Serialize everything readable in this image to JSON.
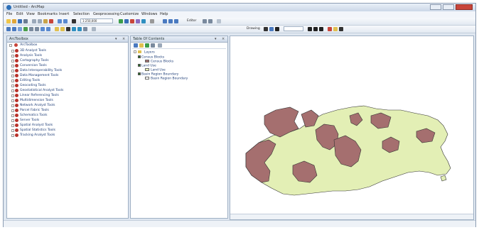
{
  "window": {
    "title": "Untitled - ArcMap",
    "controls": [
      "minimize",
      "maximize",
      "close"
    ]
  },
  "menubar": {
    "items": [
      "File",
      "Edit",
      "View",
      "Bookmarks",
      "Insert",
      "Selection",
      "Geoprocessing",
      "Customize",
      "Windows",
      "Help"
    ]
  },
  "toolbar": {
    "scale_value": "1:250,000",
    "editor_label": "Editor",
    "drawing_label": "Drawing"
  },
  "toolbox_pane": {
    "title": "ArcToolbox",
    "root": "ArcToolbox",
    "items": [
      "3D Analyst Tools",
      "Analysis Tools",
      "Cartography Tools",
      "Conversion Tools",
      "Data Interoperability Tools",
      "Data Management Tools",
      "Editing Tools",
      "Geocoding Tools",
      "Geostatistical Analyst Tools",
      "Linear Referencing Tools",
      "Multidimension Tools",
      "Network Analyst Tools",
      "Parcel Fabric Tools",
      "Schematics Tools",
      "Server Tools",
      "Spatial Analyst Tools",
      "Spatial Statistics Tools",
      "Tracking Analyst Tools"
    ]
  },
  "toc_pane": {
    "title": "Table Of Contents",
    "layers_root": "Layers",
    "entries": [
      {
        "level": 1,
        "label": "Census Blocks",
        "type": "layer",
        "checked": true
      },
      {
        "level": 2,
        "label": "Census Blocks",
        "type": "symbol",
        "color": "#a56f6f"
      },
      {
        "level": 1,
        "label": "Land Use",
        "type": "layer",
        "checked": true
      },
      {
        "level": 2,
        "label": "Land Use",
        "type": "symbol",
        "color": "#e6f0b4"
      },
      {
        "level": 1,
        "label": "Basin Region Boundary",
        "type": "layer",
        "checked": true
      },
      {
        "level": 2,
        "label": "Basin Region Boundary",
        "type": "symbol",
        "color": "#ffffff"
      }
    ]
  },
  "map": {
    "land_color": "#e3efb5",
    "zone_color": "#a56f6f",
    "outline_color": "#333333"
  },
  "statusbar": {
    "coords": ""
  }
}
